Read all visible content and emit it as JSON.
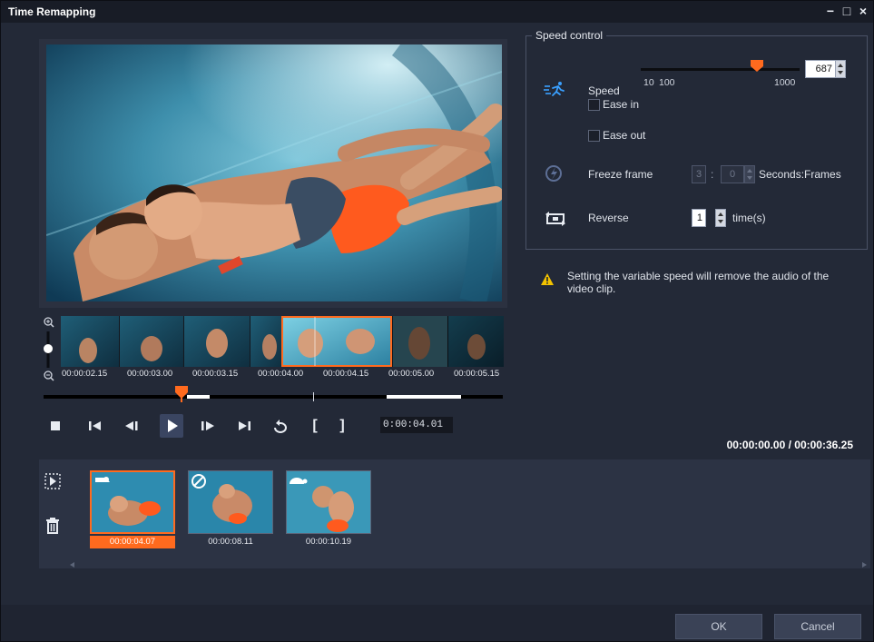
{
  "window": {
    "title": "Time Remapping",
    "controls": {
      "minimize": "−",
      "maximize": "□",
      "close": "×"
    }
  },
  "timeline": {
    "tick_labels": [
      "00:00:02.15",
      "00:00:03.00",
      "00:00:03.15",
      "00:00:04.00",
      "00:00:04.15",
      "00:00:05.00",
      "00:00:05.15"
    ]
  },
  "transport": {
    "icons": [
      "stop-icon",
      "go-to-start-icon",
      "previous-frame-icon",
      "play-icon",
      "next-frame-icon",
      "go-to-end-icon",
      "repeat-icon",
      "mark-in-icon",
      "mark-out-icon"
    ],
    "mark_in_label": "[",
    "mark_out_label": "]",
    "timecode": "0:00:04.01",
    "total_time": "00:00:00.00 / 00:00:36.25"
  },
  "speed_control": {
    "group_title": "Speed control",
    "speed": {
      "label": "Speed",
      "value": "687",
      "ticks": [
        "10",
        "100",
        "1000"
      ],
      "slider_min": 10,
      "slider_max": 1000,
      "slider_value": 687
    },
    "ease_in": {
      "label": "Ease in",
      "checked": false
    },
    "ease_out": {
      "label": "Ease out",
      "checked": false
    },
    "freeze_frame": {
      "label": "Freeze frame",
      "seconds": "3",
      "separator": ":",
      "frames": "0",
      "unit": "Seconds:Frames"
    },
    "reverse": {
      "label": "Reverse",
      "value": "1",
      "unit": "time(s)"
    }
  },
  "warning": {
    "text": "Setting the variable speed will remove the audio of the video clip."
  },
  "clip_bin": {
    "clips": [
      {
        "time": "00:00:04.07",
        "badge": "speed-up-icon",
        "selected": true
      },
      {
        "time": "00:00:08.11",
        "badge": "freeze-frame-icon",
        "selected": false
      },
      {
        "time": "00:00:10.19",
        "badge": "slow-motion-icon",
        "selected": false
      }
    ]
  },
  "footer": {
    "ok_label": "OK",
    "cancel_label": "Cancel"
  },
  "colors": {
    "accent": "#ff6a1e",
    "panel": "#232937",
    "bin": "#2c3344",
    "speed_icon": "#3aa0ff",
    "warning": "#f2c200"
  }
}
